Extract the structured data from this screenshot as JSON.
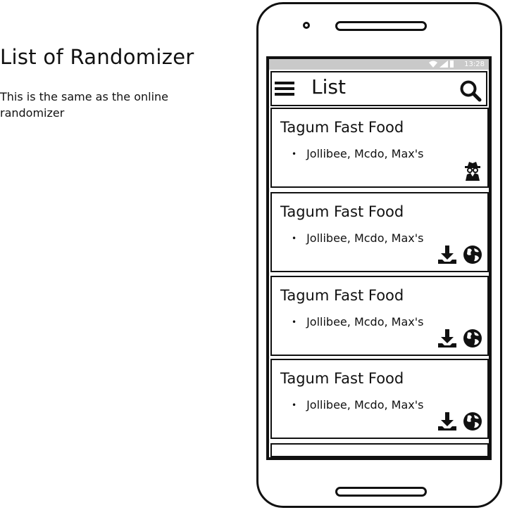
{
  "note": {
    "title": "List of Randomizer",
    "body": "This is the same as the online randomizer"
  },
  "status_bar": {
    "time": "13:28"
  },
  "app_bar": {
    "title": "List"
  },
  "cards": [
    {
      "title": "Tagum Fast Food",
      "item": "Jollibee, Mcdo, Max's",
      "icons": [
        "incognito-icon"
      ]
    },
    {
      "title": "Tagum Fast Food",
      "item": "Jollibee, Mcdo, Max's",
      "icons": [
        "download-icon",
        "globe-icon"
      ]
    },
    {
      "title": "Tagum Fast Food",
      "item": "Jollibee, Mcdo, Max's",
      "icons": [
        "download-icon",
        "globe-icon"
      ]
    },
    {
      "title": "Tagum Fast Food",
      "item": "Jollibee, Mcdo, Max's",
      "icons": [
        "download-icon",
        "globe-icon"
      ]
    }
  ],
  "bullet": "•"
}
